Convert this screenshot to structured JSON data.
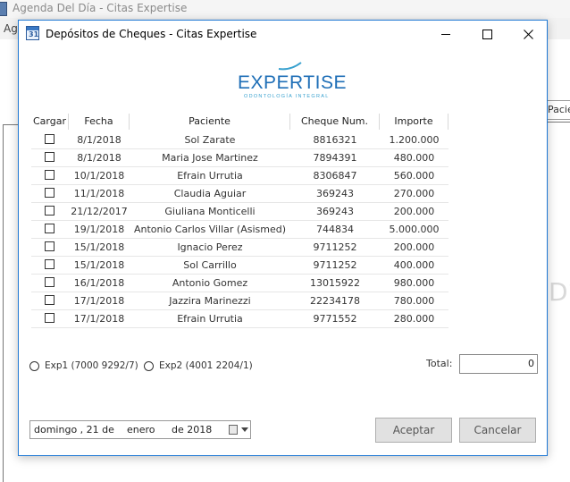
{
  "background_window": {
    "title": "Agenda Del Día - Citas Expertise",
    "menu_partial": "Ag",
    "right_tab_partial": "Pacie",
    "big_text_partial": "Día"
  },
  "dialog": {
    "title": "Depósitos de Cheques - Citas Expertise",
    "icon_text": "31"
  },
  "logo": {
    "wordmark": "EXPERTISE",
    "tagline": "ODONTOLOGÍA INTEGRAL",
    "color": "#1f6fb7"
  },
  "table": {
    "headers": [
      "Cargar",
      "Fecha",
      "Paciente",
      "Cheque Num.",
      "Importe"
    ],
    "rows": [
      {
        "fecha": "8/1/2018",
        "paciente": "Sol Zarate",
        "cheque": "8816321",
        "importe": "1.200.000"
      },
      {
        "fecha": "8/1/2018",
        "paciente": "Maria Jose Martinez",
        "cheque": "7894391",
        "importe": "480.000"
      },
      {
        "fecha": "10/1/2018",
        "paciente": "Efrain Urrutia",
        "cheque": "8306847",
        "importe": "560.000"
      },
      {
        "fecha": "11/1/2018",
        "paciente": "Claudia Aguiar",
        "cheque": "369243",
        "importe": "270.000"
      },
      {
        "fecha": "21/12/2017",
        "paciente": "Giuliana  Monticelli",
        "cheque": "369243",
        "importe": "200.000"
      },
      {
        "fecha": "19/1/2018",
        "paciente": "Antonio Carlos Villar (Asismed)",
        "cheque": "744834",
        "importe": "5.000.000"
      },
      {
        "fecha": "15/1/2018",
        "paciente": "Ignacio Perez",
        "cheque": "9711252",
        "importe": "200.000"
      },
      {
        "fecha": "15/1/2018",
        "paciente": "Sol Carrillo",
        "cheque": "9711252",
        "importe": "400.000"
      },
      {
        "fecha": "16/1/2018",
        "paciente": "Antonio Gomez",
        "cheque": "13015922",
        "importe": "980.000"
      },
      {
        "fecha": "17/1/2018",
        "paciente": "Jazzira Marinezzi",
        "cheque": "22234178",
        "importe": "780.000"
      },
      {
        "fecha": "17/1/2018",
        "paciente": "Efrain Urrutia",
        "cheque": "9771552",
        "importe": "280.000"
      }
    ]
  },
  "accounts": {
    "exp1_label": "Exp1 (7000 9292/7)",
    "exp2_label": "Exp2 (4001 2204/1)"
  },
  "total": {
    "label": "Total:",
    "value": "0"
  },
  "date_picker": {
    "day_of_week": "domingo , 21 de",
    "month": "enero",
    "year": "de 2018"
  },
  "buttons": {
    "accept": "Aceptar",
    "cancel": "Cancelar"
  }
}
